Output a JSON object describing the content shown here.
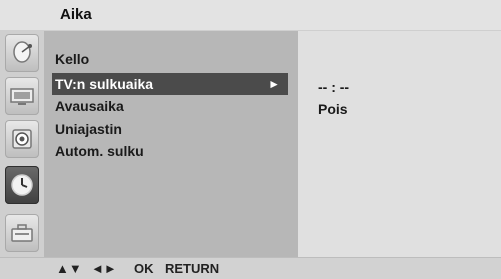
{
  "header": {
    "title": "Aika"
  },
  "menu": {
    "items": [
      {
        "label": "Kello"
      },
      {
        "label": "TV:n sulkuaika",
        "arrow": "►"
      },
      {
        "label": "Avausaika"
      },
      {
        "label": "Uniajastin"
      },
      {
        "label": "Autom. sulku"
      }
    ]
  },
  "submenu": {
    "time_value": "-- : --",
    "state_value": "Pois"
  },
  "footer": {
    "up_down": "▲▼",
    "left_right": "◄►",
    "ok": "OK",
    "return": "RETURN"
  },
  "icons": [
    "satellite-dish-icon",
    "tv-picture-icon",
    "audio-speaker-icon",
    "clock-icon",
    "toolbox-icon"
  ]
}
